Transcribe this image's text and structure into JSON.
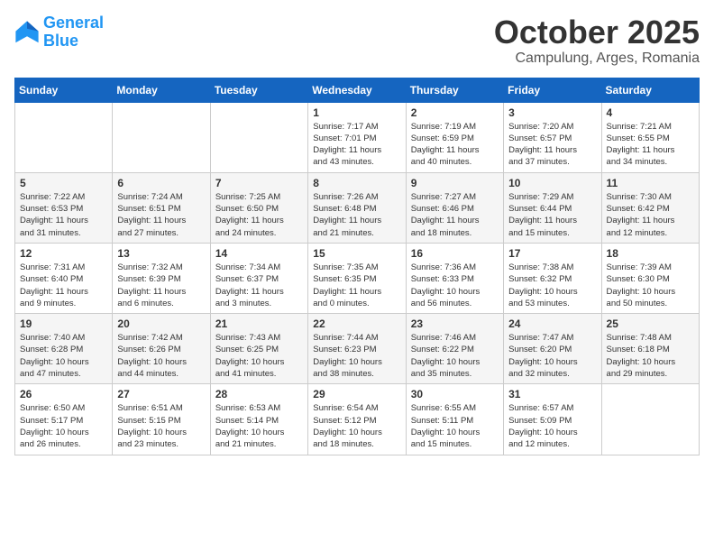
{
  "header": {
    "logo_line1": "General",
    "logo_line2": "Blue",
    "month": "October 2025",
    "location": "Campulung, Arges, Romania"
  },
  "weekdays": [
    "Sunday",
    "Monday",
    "Tuesday",
    "Wednesday",
    "Thursday",
    "Friday",
    "Saturday"
  ],
  "weeks": [
    [
      {
        "day": "",
        "info": ""
      },
      {
        "day": "",
        "info": ""
      },
      {
        "day": "",
        "info": ""
      },
      {
        "day": "1",
        "info": "Sunrise: 7:17 AM\nSunset: 7:01 PM\nDaylight: 11 hours\nand 43 minutes."
      },
      {
        "day": "2",
        "info": "Sunrise: 7:19 AM\nSunset: 6:59 PM\nDaylight: 11 hours\nand 40 minutes."
      },
      {
        "day": "3",
        "info": "Sunrise: 7:20 AM\nSunset: 6:57 PM\nDaylight: 11 hours\nand 37 minutes."
      },
      {
        "day": "4",
        "info": "Sunrise: 7:21 AM\nSunset: 6:55 PM\nDaylight: 11 hours\nand 34 minutes."
      }
    ],
    [
      {
        "day": "5",
        "info": "Sunrise: 7:22 AM\nSunset: 6:53 PM\nDaylight: 11 hours\nand 31 minutes."
      },
      {
        "day": "6",
        "info": "Sunrise: 7:24 AM\nSunset: 6:51 PM\nDaylight: 11 hours\nand 27 minutes."
      },
      {
        "day": "7",
        "info": "Sunrise: 7:25 AM\nSunset: 6:50 PM\nDaylight: 11 hours\nand 24 minutes."
      },
      {
        "day": "8",
        "info": "Sunrise: 7:26 AM\nSunset: 6:48 PM\nDaylight: 11 hours\nand 21 minutes."
      },
      {
        "day": "9",
        "info": "Sunrise: 7:27 AM\nSunset: 6:46 PM\nDaylight: 11 hours\nand 18 minutes."
      },
      {
        "day": "10",
        "info": "Sunrise: 7:29 AM\nSunset: 6:44 PM\nDaylight: 11 hours\nand 15 minutes."
      },
      {
        "day": "11",
        "info": "Sunrise: 7:30 AM\nSunset: 6:42 PM\nDaylight: 11 hours\nand 12 minutes."
      }
    ],
    [
      {
        "day": "12",
        "info": "Sunrise: 7:31 AM\nSunset: 6:40 PM\nDaylight: 11 hours\nand 9 minutes."
      },
      {
        "day": "13",
        "info": "Sunrise: 7:32 AM\nSunset: 6:39 PM\nDaylight: 11 hours\nand 6 minutes."
      },
      {
        "day": "14",
        "info": "Sunrise: 7:34 AM\nSunset: 6:37 PM\nDaylight: 11 hours\nand 3 minutes."
      },
      {
        "day": "15",
        "info": "Sunrise: 7:35 AM\nSunset: 6:35 PM\nDaylight: 11 hours\nand 0 minutes."
      },
      {
        "day": "16",
        "info": "Sunrise: 7:36 AM\nSunset: 6:33 PM\nDaylight: 10 hours\nand 56 minutes."
      },
      {
        "day": "17",
        "info": "Sunrise: 7:38 AM\nSunset: 6:32 PM\nDaylight: 10 hours\nand 53 minutes."
      },
      {
        "day": "18",
        "info": "Sunrise: 7:39 AM\nSunset: 6:30 PM\nDaylight: 10 hours\nand 50 minutes."
      }
    ],
    [
      {
        "day": "19",
        "info": "Sunrise: 7:40 AM\nSunset: 6:28 PM\nDaylight: 10 hours\nand 47 minutes."
      },
      {
        "day": "20",
        "info": "Sunrise: 7:42 AM\nSunset: 6:26 PM\nDaylight: 10 hours\nand 44 minutes."
      },
      {
        "day": "21",
        "info": "Sunrise: 7:43 AM\nSunset: 6:25 PM\nDaylight: 10 hours\nand 41 minutes."
      },
      {
        "day": "22",
        "info": "Sunrise: 7:44 AM\nSunset: 6:23 PM\nDaylight: 10 hours\nand 38 minutes."
      },
      {
        "day": "23",
        "info": "Sunrise: 7:46 AM\nSunset: 6:22 PM\nDaylight: 10 hours\nand 35 minutes."
      },
      {
        "day": "24",
        "info": "Sunrise: 7:47 AM\nSunset: 6:20 PM\nDaylight: 10 hours\nand 32 minutes."
      },
      {
        "day": "25",
        "info": "Sunrise: 7:48 AM\nSunset: 6:18 PM\nDaylight: 10 hours\nand 29 minutes."
      }
    ],
    [
      {
        "day": "26",
        "info": "Sunrise: 6:50 AM\nSunset: 5:17 PM\nDaylight: 10 hours\nand 26 minutes."
      },
      {
        "day": "27",
        "info": "Sunrise: 6:51 AM\nSunset: 5:15 PM\nDaylight: 10 hours\nand 23 minutes."
      },
      {
        "day": "28",
        "info": "Sunrise: 6:53 AM\nSunset: 5:14 PM\nDaylight: 10 hours\nand 21 minutes."
      },
      {
        "day": "29",
        "info": "Sunrise: 6:54 AM\nSunset: 5:12 PM\nDaylight: 10 hours\nand 18 minutes."
      },
      {
        "day": "30",
        "info": "Sunrise: 6:55 AM\nSunset: 5:11 PM\nDaylight: 10 hours\nand 15 minutes."
      },
      {
        "day": "31",
        "info": "Sunrise: 6:57 AM\nSunset: 5:09 PM\nDaylight: 10 hours\nand 12 minutes."
      },
      {
        "day": "",
        "info": ""
      }
    ]
  ]
}
